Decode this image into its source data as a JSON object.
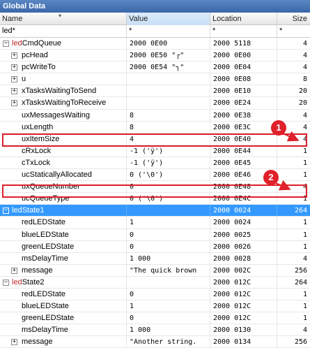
{
  "window": {
    "title": "Global Data"
  },
  "columns": {
    "name": "Name",
    "value": "Value",
    "location": "Location",
    "size": "Size"
  },
  "filter": {
    "name": "led*",
    "value": "*",
    "location": "*",
    "size": "*"
  },
  "rows": [
    {
      "expander": "−",
      "prefix": "led",
      "rest": "CmdQueue",
      "value": "2000 0E00",
      "location": "2000 5118",
      "size": "4"
    },
    {
      "expander": "+",
      "prefix": "",
      "rest": "pcHead",
      "value": "2000 0E50 \"┌\"",
      "location": "2000 0E00",
      "size": "4"
    },
    {
      "expander": "+",
      "prefix": "",
      "rest": "pcWriteTo",
      "value": "2000 0E54 \"┐\"",
      "location": "2000 0E04",
      "size": "4"
    },
    {
      "expander": "+",
      "prefix": "",
      "rest": "u",
      "value": "",
      "location": "2000 0E08",
      "size": "8"
    },
    {
      "expander": "+",
      "prefix": "",
      "rest": "xTasksWaitingToSend",
      "value": "",
      "location": "2000 0E10",
      "size": "20"
    },
    {
      "expander": "+",
      "prefix": "",
      "rest": "xTasksWaitingToReceive",
      "value": "",
      "location": "2000 0E24",
      "size": "20"
    },
    {
      "expander": "",
      "prefix": "",
      "rest": "uxMessagesWaiting",
      "value": "8",
      "location": "2000 0E38",
      "size": "4"
    },
    {
      "expander": "",
      "prefix": "",
      "rest": "uxLength",
      "value": "8",
      "location": "2000 0E3C",
      "size": "4"
    },
    {
      "expander": "",
      "prefix": "",
      "rest": "uxItemSize",
      "value": "4",
      "location": "2000 0E40",
      "size": "4"
    },
    {
      "expander": "",
      "prefix": "",
      "rest": "cRxLock",
      "value": "-1 ('ÿ')",
      "location": "2000 0E44",
      "size": "1"
    },
    {
      "expander": "",
      "prefix": "",
      "rest": "cTxLock",
      "value": "-1 ('ÿ')",
      "location": "2000 0E45",
      "size": "1"
    },
    {
      "expander": "",
      "prefix": "",
      "rest": "ucStaticallyAllocated",
      "value": "0 ('\\0')",
      "location": "2000 0E46",
      "size": "1"
    },
    {
      "expander": "",
      "prefix": "",
      "rest": "uxQueueNumber",
      "value": "0",
      "location": "2000 0E48",
      "size": "4"
    },
    {
      "expander": "",
      "prefix": "",
      "rest": "ucQueueType",
      "value": "0 ('\\0')",
      "location": "2000 0E4C",
      "size": "1"
    },
    {
      "expander": "−",
      "prefix": "led",
      "rest": "State1",
      "value": "",
      "location": "2000 0024",
      "size": "264"
    },
    {
      "expander": "",
      "prefix": "",
      "rest": "redLEDState",
      "value": "1",
      "location": "2000 0024",
      "size": "1"
    },
    {
      "expander": "",
      "prefix": "",
      "rest": "blueLEDState",
      "value": "0",
      "location": "2000 0025",
      "size": "1"
    },
    {
      "expander": "",
      "prefix": "",
      "rest": "greenLEDState",
      "value": "0",
      "location": "2000 0026",
      "size": "1"
    },
    {
      "expander": "",
      "prefix": "",
      "rest": "msDelayTime",
      "value": "1 000",
      "location": "2000 0028",
      "size": "4"
    },
    {
      "expander": "+",
      "prefix": "",
      "rest": "message",
      "value": "\"The quick brown",
      "location": "2000 002C",
      "size": "256"
    },
    {
      "expander": "−",
      "prefix": "led",
      "rest": "State2",
      "value": "",
      "location": "2000 012C",
      "size": "264"
    },
    {
      "expander": "",
      "prefix": "",
      "rest": "redLEDState",
      "value": "0",
      "location": "2000 012C",
      "size": "1"
    },
    {
      "expander": "",
      "prefix": "",
      "rest": "blueLEDState",
      "value": "1",
      "location": "2000 012C",
      "size": "1"
    },
    {
      "expander": "",
      "prefix": "",
      "rest": "greenLEDState",
      "value": "0",
      "location": "2000 012C",
      "size": "1"
    },
    {
      "expander": "",
      "prefix": "",
      "rest": "msDelayTime",
      "value": "1 000",
      "location": "2000 0130",
      "size": "4"
    },
    {
      "expander": "+",
      "prefix": "",
      "rest": "message",
      "value": "\"Another string.",
      "location": "2000 0134",
      "size": "256"
    }
  ],
  "annotations": {
    "badge1": "1",
    "badge2": "2"
  },
  "colors": {
    "selection": "#3399ff",
    "annotation": "#e0202a",
    "prefix": "#c0282d",
    "title": "#3a67a8"
  }
}
